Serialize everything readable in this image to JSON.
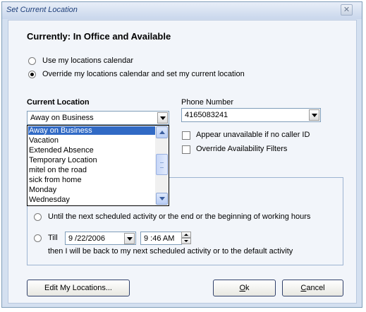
{
  "window": {
    "title": "Set Current Location",
    "close_glyph": "✕"
  },
  "status": "Currently: In Office and Available",
  "mode": {
    "use_calendar": "Use my locations calendar",
    "override_calendar": "Override my locations calendar and set my current location",
    "selected": "override_calendar"
  },
  "current_location": {
    "label": "Current Location",
    "value": "Away on Business",
    "options": [
      "Away on Business",
      "Vacation",
      "Extended Absence",
      "Temporary Location",
      "mitel on the road",
      "sick from home",
      "Monday",
      "Wednesday"
    ],
    "selected_index": 0
  },
  "phone": {
    "label": "Phone Number",
    "value": "4165083241"
  },
  "options": {
    "appear_unavailable": "Appear unavailable if no caller ID",
    "override_filters": "Override Availability Filters"
  },
  "duration": {
    "until_next": "Until the next scheduled activity or the end or the beginning of working hours",
    "till_label": "Till",
    "date": "9 /22/2006",
    "time": "9 :46 AM",
    "then_text": "then I will be back to my next scheduled activity or to the default activity"
  },
  "buttons": {
    "edit_locations": "Edit My Locations...",
    "ok_mnemonic": "O",
    "ok_rest": "k",
    "cancel_mnemonic": "C",
    "cancel_rest": "ancel"
  },
  "colors": {
    "selection": "#316ac5",
    "panel": "#f2f5fa",
    "frame": "#d4e0f0"
  }
}
